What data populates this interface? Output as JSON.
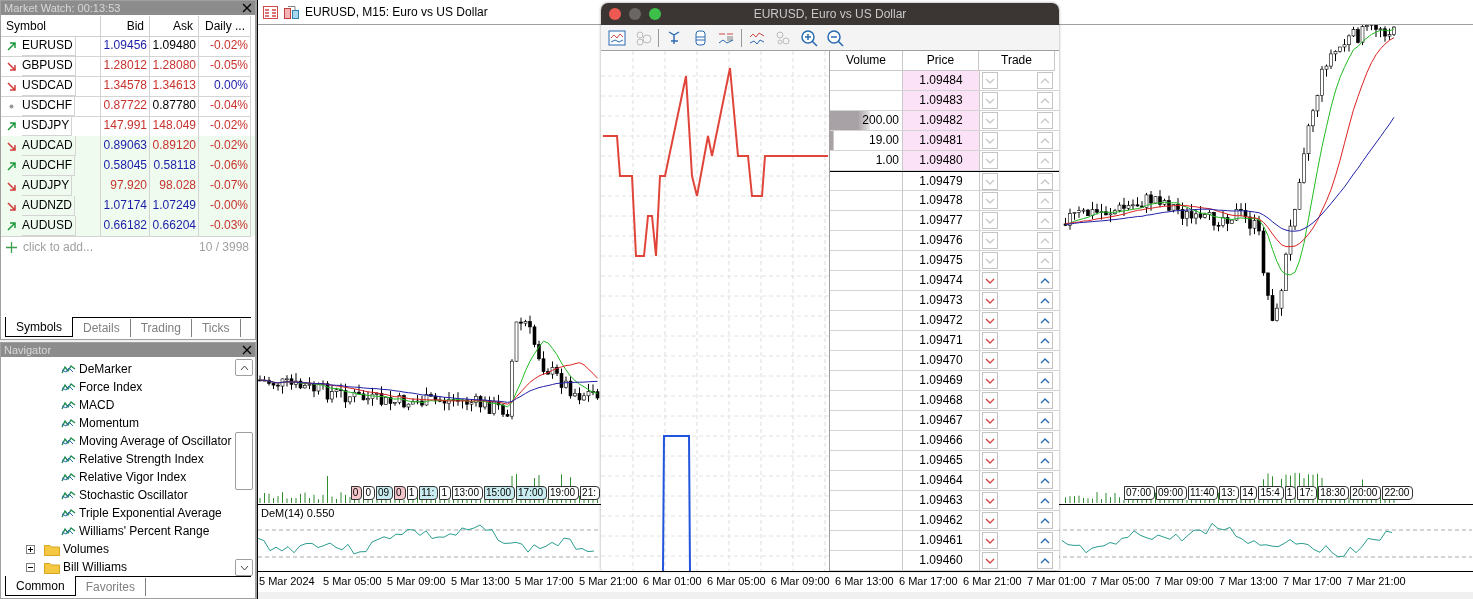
{
  "market_watch": {
    "title": "Market Watch: 00:13:53",
    "columns": [
      "Symbol",
      "Bid",
      "Ask",
      "Daily ..."
    ],
    "rows": [
      {
        "symbol": "EURUSD",
        "kind": "up",
        "bid": {
          "text": "1.09456",
          "color": "#1c1ca8"
        },
        "ask": {
          "text": "1.09480",
          "color": "#000000"
        },
        "change": {
          "text": "-0.02%",
          "color": "#c8322d"
        },
        "highlighted": false
      },
      {
        "symbol": "GBPUSD",
        "kind": "down",
        "bid": {
          "text": "1.28012",
          "color": "#c8322d"
        },
        "ask": {
          "text": "1.28080",
          "color": "#c8322d"
        },
        "change": {
          "text": "-0.05%",
          "color": "#c8322d"
        },
        "highlighted": false
      },
      {
        "symbol": "USDCAD",
        "kind": "down",
        "bid": {
          "text": "1.34578",
          "color": "#c8322d"
        },
        "ask": {
          "text": "1.34613",
          "color": "#c8322d"
        },
        "change": {
          "text": "0.00%",
          "color": "#1c1ca8"
        },
        "highlighted": false
      },
      {
        "symbol": "USDCHF",
        "kind": "flat",
        "bid": {
          "text": "0.87722",
          "color": "#c8322d"
        },
        "ask": {
          "text": "0.87780",
          "color": "#000000"
        },
        "change": {
          "text": "-0.04%",
          "color": "#c8322d"
        },
        "highlighted": false
      },
      {
        "symbol": "USDJPY",
        "kind": "up",
        "bid": {
          "text": "147.991",
          "color": "#c8322d"
        },
        "ask": {
          "text": "148.049",
          "color": "#c8322d"
        },
        "change": {
          "text": "-0.02%",
          "color": "#c8322d"
        },
        "highlighted": false
      },
      {
        "symbol": "AUDCAD",
        "kind": "down",
        "bid": {
          "text": "0.89063",
          "color": "#1c1ca8"
        },
        "ask": {
          "text": "0.89120",
          "color": "#c8322d"
        },
        "change": {
          "text": "-0.02%",
          "color": "#c8322d"
        },
        "highlighted": true
      },
      {
        "symbol": "AUDCHF",
        "kind": "up",
        "bid": {
          "text": "0.58045",
          "color": "#1c1ca8"
        },
        "ask": {
          "text": "0.58118",
          "color": "#1c1ca8"
        },
        "change": {
          "text": "-0.06%",
          "color": "#c8322d"
        },
        "highlighted": true
      },
      {
        "symbol": "AUDJPY",
        "kind": "down",
        "bid": {
          "text": "97.920",
          "color": "#c8322d"
        },
        "ask": {
          "text": "98.028",
          "color": "#c8322d"
        },
        "change": {
          "text": "-0.07%",
          "color": "#c8322d"
        },
        "highlighted": true
      },
      {
        "symbol": "AUDNZD",
        "kind": "down",
        "bid": {
          "text": "1.07174",
          "color": "#1c1ca8"
        },
        "ask": {
          "text": "1.07249",
          "color": "#1c1ca8"
        },
        "change": {
          "text": "-0.00%",
          "color": "#c8322d"
        },
        "highlighted": true
      },
      {
        "symbol": "AUDUSD",
        "kind": "up",
        "bid": {
          "text": "0.66182",
          "color": "#1c1ca8"
        },
        "ask": {
          "text": "0.66204",
          "color": "#1c1ca8"
        },
        "change": {
          "text": "-0.03%",
          "color": "#c8322d"
        },
        "highlighted": true
      }
    ],
    "add_label": "click to add...",
    "count": "10 / 3998",
    "tabs": [
      {
        "label": "Symbols",
        "selected": true
      },
      {
        "label": "Details",
        "selected": false
      },
      {
        "label": "Trading",
        "selected": false
      },
      {
        "label": "Ticks",
        "selected": false
      }
    ]
  },
  "navigator": {
    "title": "Navigator",
    "tree": [
      {
        "children": [
          {
            "label": "DeMarker",
            "kind": "indicator"
          },
          {
            "label": "Force Index",
            "kind": "indicator"
          },
          {
            "label": "MACD",
            "kind": "indicator"
          },
          {
            "label": "Momentum",
            "kind": "indicator"
          },
          {
            "label": "Moving Average of Oscillator",
            "kind": "indicator"
          },
          {
            "label": "Relative Strength Index",
            "kind": "indicator"
          },
          {
            "label": "Relative Vigor Index",
            "kind": "indicator"
          },
          {
            "label": "Stochastic Oscillator",
            "kind": "indicator"
          },
          {
            "label": "Triple Exponential Average",
            "kind": "indicator"
          },
          {
            "label": "Williams' Percent Range",
            "kind": "indicator"
          }
        ]
      },
      {
        "label": "Volumes",
        "kind": "folder",
        "expanded": false
      },
      {
        "label": "Bill Williams",
        "kind": "folder",
        "expanded": true
      }
    ],
    "tabs": [
      {
        "label": "Common",
        "selected": true
      },
      {
        "label": "Favorites",
        "selected": false
      }
    ]
  },
  "chart": {
    "title": "EURUSD, M15:  Euro vs US Dollar",
    "tags_left": [
      {
        "text": "0",
        "color": "#f4c6cc"
      },
      {
        "text": "0",
        "color": "#ffffff"
      },
      {
        "text": "09",
        "color": "#c8ecf0"
      },
      {
        "text": "0",
        "color": "#f4c6cc"
      },
      {
        "text": "1",
        "color": "#ffffff"
      },
      {
        "text": "11:",
        "color": "#c8ecf0"
      },
      {
        "text": "1",
        "color": "#ffffff"
      },
      {
        "text": "13:00",
        "color": "#ffffff"
      },
      {
        "text": "15:00",
        "color": "#c8ecf0"
      },
      {
        "text": "17:00",
        "color": "#c8ecf0"
      },
      {
        "text": "19:00",
        "color": "#ffffff"
      },
      {
        "text": "21:",
        "color": "#ffffff"
      }
    ],
    "tags_right": [
      {
        "text": "07:00",
        "color": "#ffffff"
      },
      {
        "text": "09:00",
        "color": "#ffffff"
      },
      {
        "text": "11:40",
        "color": "#ffffff"
      },
      {
        "text": "13:",
        "color": "#ffffff"
      },
      {
        "text": "14",
        "color": "#ffffff"
      },
      {
        "text": "15:4",
        "color": "#ffffff"
      },
      {
        "text": "1",
        "color": "#ffffff"
      },
      {
        "text": "17:",
        "color": "#ffffff"
      },
      {
        "text": "18:30",
        "color": "#ffffff"
      },
      {
        "text": "20:00",
        "color": "#ffffff"
      },
      {
        "text": "22:00",
        "color": "#ffffff"
      }
    ],
    "indicator_label": "DeM(14) 0.550",
    "time_labels": [
      "5 Mar 2024",
      "5 Mar 05:00",
      "5 Mar 09:00",
      "5 Mar 13:00",
      "5 Mar 17:00",
      "5 Mar 21:00",
      "6 Mar 01:00",
      "6 Mar 05:00",
      "6 Mar 09:00",
      "6 Mar 13:00",
      "6 Mar 17:00",
      "6 Mar 21:00",
      "7 Mar 01:00",
      "7 Mar 05:00",
      "7 Mar 09:00",
      "7 Mar 13:00",
      "7 Mar 17:00",
      "7 Mar 21:00"
    ]
  },
  "depth_window": {
    "title": "EURUSD, Euro vs US Dollar",
    "columns": [
      "Volume",
      "Price",
      "Trade"
    ],
    "rows": [
      {
        "price": "1.09484",
        "kind": "ask",
        "disabled": true
      },
      {
        "price": "1.09483",
        "kind": "ask",
        "disabled": true
      },
      {
        "price": "1.09482",
        "kind": "ask",
        "volume": "200.00",
        "level": 0.55,
        "disabled": true
      },
      {
        "price": "1.09481",
        "kind": "ask",
        "volume": "19.00",
        "level": 0.06,
        "disabled": true
      },
      {
        "price": "1.09480",
        "kind": "ask",
        "volume": "1.00",
        "disabled": true
      },
      {
        "price": "1.09479",
        "kind": "bid",
        "disabled": true
      },
      {
        "price": "1.09478",
        "kind": "bid",
        "disabled": true
      },
      {
        "price": "1.09477",
        "kind": "bid",
        "disabled": true
      },
      {
        "price": "1.09476",
        "kind": "bid",
        "disabled": true
      },
      {
        "price": "1.09475",
        "kind": "bid",
        "disabled": true
      },
      {
        "price": "1.09474",
        "kind": "bid",
        "disabled": false
      },
      {
        "price": "1.09473",
        "kind": "bid",
        "disabled": false
      },
      {
        "price": "1.09472",
        "kind": "bid",
        "disabled": false
      },
      {
        "price": "1.09471",
        "kind": "bid",
        "disabled": false
      },
      {
        "price": "1.09470",
        "kind": "bid",
        "disabled": false
      },
      {
        "price": "1.09469",
        "kind": "bid",
        "disabled": false
      },
      {
        "price": "1.09468",
        "kind": "bid",
        "disabled": false
      },
      {
        "price": "1.09467",
        "kind": "bid",
        "disabled": false
      },
      {
        "price": "1.09466",
        "kind": "bid",
        "disabled": false
      },
      {
        "price": "1.09465",
        "kind": "bid",
        "disabled": false
      },
      {
        "price": "1.09464",
        "kind": "bid",
        "disabled": false
      },
      {
        "price": "1.09463",
        "kind": "bid",
        "disabled": false
      },
      {
        "price": "1.09462",
        "kind": "bid",
        "disabled": false
      },
      {
        "price": "1.09461",
        "kind": "bid",
        "disabled": false
      },
      {
        "price": "1.09460",
        "kind": "bid",
        "disabled": false
      }
    ]
  }
}
